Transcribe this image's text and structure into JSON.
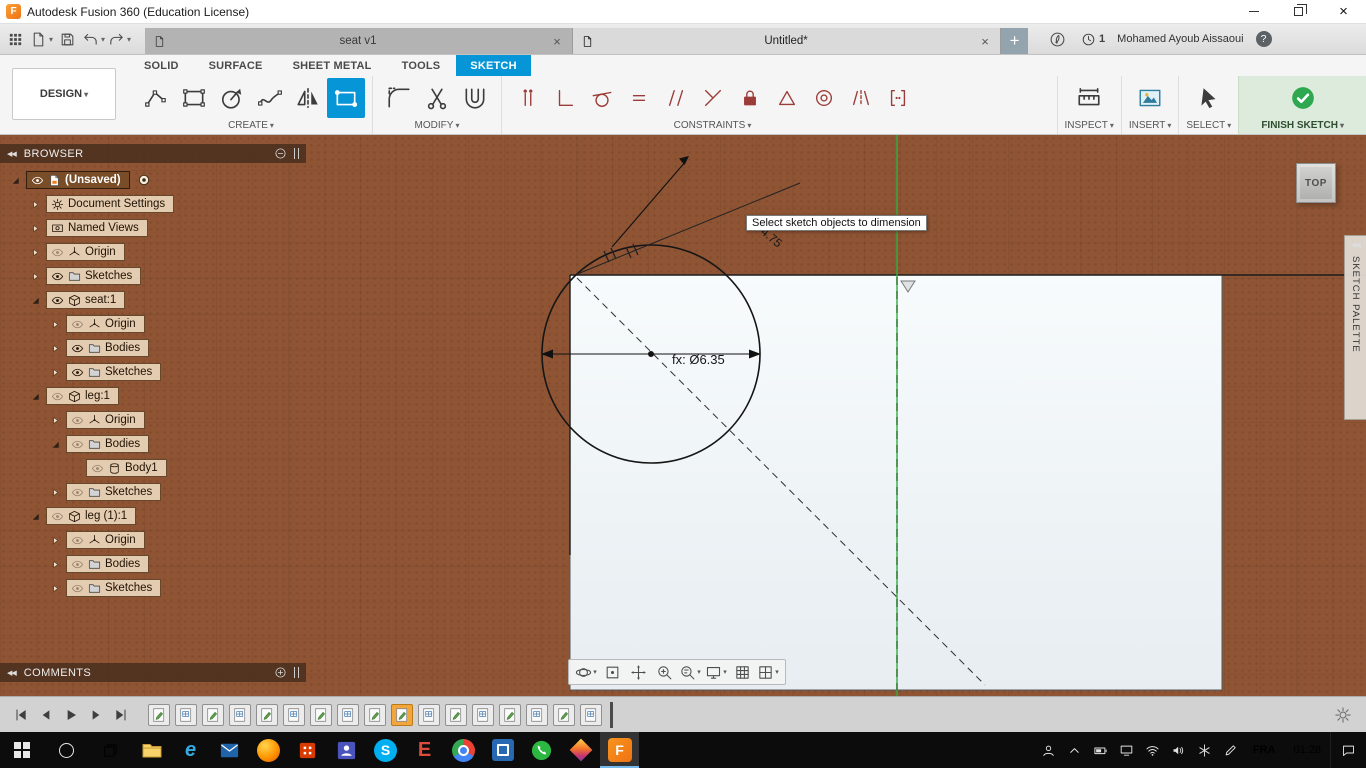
{
  "window_title": "Autodesk Fusion 360 (Education License)",
  "document_tabs": [
    {
      "label": "seat v1"
    },
    {
      "label": "Untitled*",
      "active": true
    }
  ],
  "appbar": {
    "user_name": "Mohamed Ayoub Aissaoui",
    "notification_count": "1",
    "help_glyph": "?"
  },
  "ribbon": {
    "design_label": "DESIGN",
    "tabs": [
      {
        "label": "SOLID"
      },
      {
        "label": "SURFACE"
      },
      {
        "label": "SHEET METAL"
      },
      {
        "label": "TOOLS"
      },
      {
        "label": "SKETCH",
        "active": true
      }
    ],
    "groups": [
      {
        "label": "CREATE",
        "tools": [
          {
            "name": "line-tool",
            "icon": "line"
          },
          {
            "name": "rectangle-tool",
            "icon": "rect"
          },
          {
            "name": "circle-tool",
            "icon": "circle2"
          },
          {
            "name": "spline-tool",
            "icon": "spline"
          },
          {
            "name": "mirror-tool",
            "icon": "mirror"
          },
          {
            "name": "two-point-rectangle-tool",
            "icon": "rect2",
            "selected": true
          }
        ]
      },
      {
        "label": "MODIFY",
        "tools": [
          {
            "name": "fillet-tool",
            "icon": "fillet"
          },
          {
            "name": "trim-tool",
            "icon": "trim"
          },
          {
            "name": "offset-tool",
            "icon": "offset"
          }
        ]
      },
      {
        "label": "CONSTRAINTS",
        "constraint": true,
        "tools": [
          {
            "name": "coincident-constraint",
            "icon": "coincident"
          },
          {
            "name": "horizontal-vertical-constraint",
            "icon": "horizvert"
          },
          {
            "name": "tangent-constraint",
            "icon": "tangent"
          },
          {
            "name": "equal-constraint",
            "icon": "equal"
          },
          {
            "name": "parallel-constraint",
            "icon": "parallel"
          },
          {
            "name": "perpendicular-constraint",
            "icon": "perp"
          },
          {
            "name": "fix-unfix-constraint",
            "icon": "lock"
          },
          {
            "name": "midpoint-constraint",
            "icon": "midpoint"
          },
          {
            "name": "concentric-constraint",
            "icon": "concentric"
          },
          {
            "name": "symmetry-constraint",
            "icon": "symmetry"
          },
          {
            "name": "curvature-constraint",
            "icon": "curvature"
          }
        ]
      },
      {
        "label": "INSPECT",
        "right": true,
        "tools": [
          {
            "name": "measure-tool",
            "icon": "measure"
          }
        ]
      },
      {
        "label": "INSERT",
        "tools": [
          {
            "name": "insert-image-tool",
            "icon": "image"
          }
        ]
      },
      {
        "label": "SELECT",
        "tools": [
          {
            "name": "select-tool",
            "icon": "cursor"
          }
        ]
      },
      {
        "label": "FINISH SKETCH",
        "finish": true,
        "tools": [
          {
            "name": "finish-sketch-button",
            "icon": "check"
          }
        ]
      }
    ]
  },
  "browser": {
    "header": "BROWSER",
    "rows": [
      {
        "label": "(Unsaved)",
        "level": 0,
        "icon": "doc",
        "eye": "on",
        "expand": "open",
        "root": true,
        "radio": true
      },
      {
        "label": "Document Settings",
        "level": 1,
        "icon": "gear",
        "expand": "closed"
      },
      {
        "label": "Named Views",
        "level": 1,
        "icon": "views",
        "expand": "closed"
      },
      {
        "label": "Origin",
        "level": 1,
        "icon": "axes",
        "eye": "dim",
        "expand": "closed"
      },
      {
        "label": "Sketches",
        "level": 1,
        "icon": "folder",
        "eye": "on",
        "expand": "closed"
      },
      {
        "label": "seat:1",
        "level": 1,
        "icon": "cube",
        "eye": "on",
        "expand": "open"
      },
      {
        "label": "Origin",
        "level": 2,
        "icon": "axes",
        "eye": "dim",
        "expand": "closed"
      },
      {
        "label": "Bodies",
        "level": 2,
        "icon": "folder",
        "eye": "on",
        "expand": "closed"
      },
      {
        "label": "Sketches",
        "level": 2,
        "icon": "folder",
        "eye": "on",
        "expand": "closed"
      },
      {
        "label": "leg:1",
        "level": 1,
        "icon": "cube",
        "eye": "dim",
        "expand": "open"
      },
      {
        "label": "Origin",
        "level": 2,
        "icon": "axes",
        "eye": "dim",
        "expand": "closed"
      },
      {
        "label": "Bodies",
        "level": 2,
        "icon": "folder",
        "eye": "dim",
        "expand": "open"
      },
      {
        "label": "Body1",
        "level": 3,
        "icon": "body",
        "eye": "dim",
        "expand": "none"
      },
      {
        "label": "Sketches",
        "level": 2,
        "icon": "folder",
        "eye": "dim",
        "expand": "closed"
      },
      {
        "label": "leg (1):1",
        "level": 1,
        "icon": "cube",
        "eye": "dim",
        "expand": "open"
      },
      {
        "label": "Origin",
        "level": 2,
        "icon": "axes",
        "eye": "dim",
        "expand": "closed"
      },
      {
        "label": "Bodies",
        "level": 2,
        "icon": "folder",
        "eye": "dim",
        "expand": "closed"
      },
      {
        "label": "Sketches",
        "level": 2,
        "icon": "folder",
        "eye": "dim",
        "expand": "closed"
      }
    ]
  },
  "comments": {
    "header": "COMMENTS"
  },
  "canvas": {
    "tooltip": "Select sketch objects to dimension",
    "diameter_label": "fx: Ø6.35",
    "linear_dim_label": "4.75",
    "viewcube_face": "TOP",
    "palette_label": "SKETCH PALETTE"
  },
  "nav_tools": [
    {
      "name": "orbit",
      "icon": "orbit",
      "caret": true
    },
    {
      "name": "look-at",
      "icon": "lookat"
    },
    {
      "name": "pan",
      "icon": "pan"
    },
    {
      "name": "zoom",
      "icon": "zoomp"
    },
    {
      "name": "zoom-window",
      "icon": "zoomw",
      "caret": true
    },
    {
      "name": "display-settings",
      "icon": "display",
      "caret": true
    },
    {
      "name": "grid-and-snaps",
      "icon": "gridic"
    },
    {
      "name": "viewports",
      "icon": "viewports",
      "caret": true
    }
  ],
  "timeline": {
    "playback": [
      {
        "name": "skip-to-start",
        "icon": "skipstart"
      },
      {
        "name": "step-back",
        "icon": "stepback"
      },
      {
        "name": "play",
        "icon": "play"
      },
      {
        "name": "step-forward",
        "icon": "stepfwd"
      },
      {
        "name": "skip-to-end",
        "icon": "skipend"
      }
    ],
    "features": [
      {
        "type": "sketch"
      },
      {
        "type": "grid"
      },
      {
        "type": "sketch"
      },
      {
        "type": "grid"
      },
      {
        "type": "sketch"
      },
      {
        "type": "grid"
      },
      {
        "type": "sketch"
      },
      {
        "type": "grid"
      },
      {
        "type": "sketch"
      },
      {
        "type": "sketch",
        "highlighted": true
      },
      {
        "type": "grid"
      },
      {
        "type": "sketch"
      },
      {
        "type": "grid"
      },
      {
        "type": "sketch"
      },
      {
        "type": "grid"
      },
      {
        "type": "sketch"
      },
      {
        "type": "grid"
      }
    ]
  },
  "taskbar": {
    "language": "FRA",
    "time": "01:28",
    "apps": [
      {
        "name": "file-explorer",
        "kind": "folder"
      },
      {
        "name": "edge",
        "kind": "edge",
        "glyph": "e"
      },
      {
        "name": "mail",
        "kind": "mail"
      },
      {
        "name": "firefox",
        "kind": "firefox"
      },
      {
        "name": "office",
        "kind": "office"
      },
      {
        "name": "teams",
        "kind": "teams"
      },
      {
        "name": "skype",
        "kind": "skype",
        "glyph": "S"
      },
      {
        "name": "internet-explorer",
        "kind": "redE",
        "glyph": "E"
      },
      {
        "name": "chrome",
        "kind": "chrome"
      },
      {
        "name": "app-blue",
        "kind": "blueapp"
      },
      {
        "name": "whatsapp",
        "kind": "whatsapp"
      },
      {
        "name": "photos",
        "kind": "photos"
      },
      {
        "name": "fusion-360",
        "kind": "fusion",
        "glyph": "F",
        "active": true
      }
    ],
    "tray": [
      "people",
      "hidden-icons",
      "battery",
      "display",
      "network",
      "volume",
      "weather",
      "pen"
    ]
  }
}
